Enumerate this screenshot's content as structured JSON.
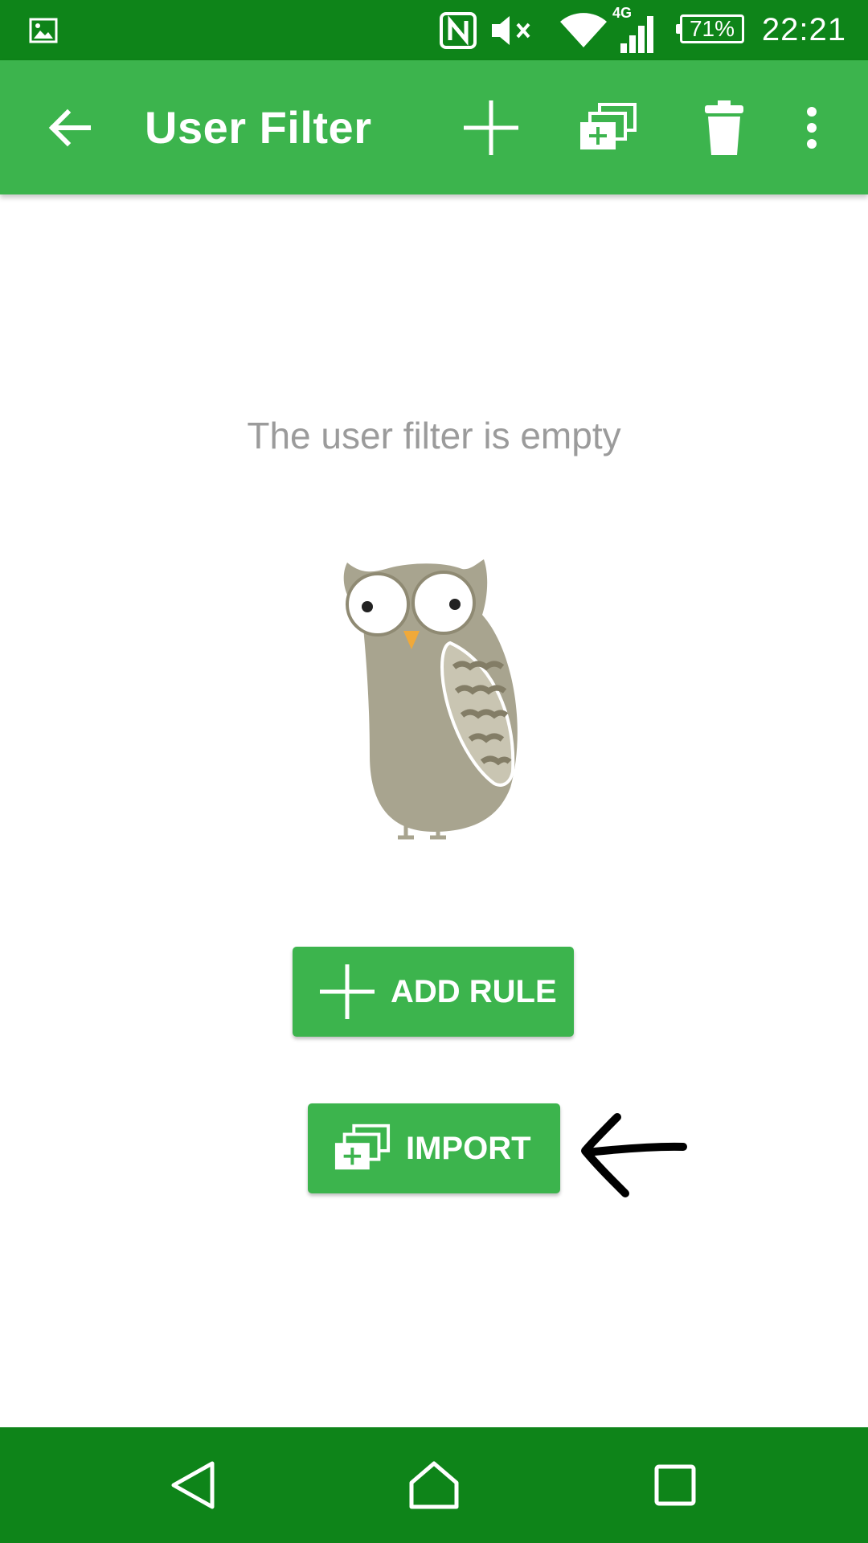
{
  "status_bar": {
    "time": "22:21",
    "battery": "71%",
    "network": "4G",
    "icons": [
      "image-notification-icon",
      "nfc-icon",
      "mute-icon",
      "wifi-icon",
      "cell-signal-icon",
      "battery-icon"
    ]
  },
  "app_bar": {
    "title": "User Filter",
    "icons": [
      "back-arrow-icon",
      "add-icon",
      "import-icon",
      "trash-icon",
      "overflow-menu-icon"
    ]
  },
  "main": {
    "empty_message": "The user filter is empty",
    "illustration": "owl-illustration",
    "add_rule_label": "ADD RULE",
    "import_label": "IMPORT",
    "annotation": "hand-drawn-arrow"
  },
  "nav_bar": {
    "icons": [
      "back-triangle-icon",
      "home-icon",
      "recents-icon"
    ]
  },
  "colors": {
    "status_bar": "#0e8419",
    "app_bar": "#3cb44d",
    "button": "#3cb44d",
    "empty_text": "#9b9b9b"
  }
}
